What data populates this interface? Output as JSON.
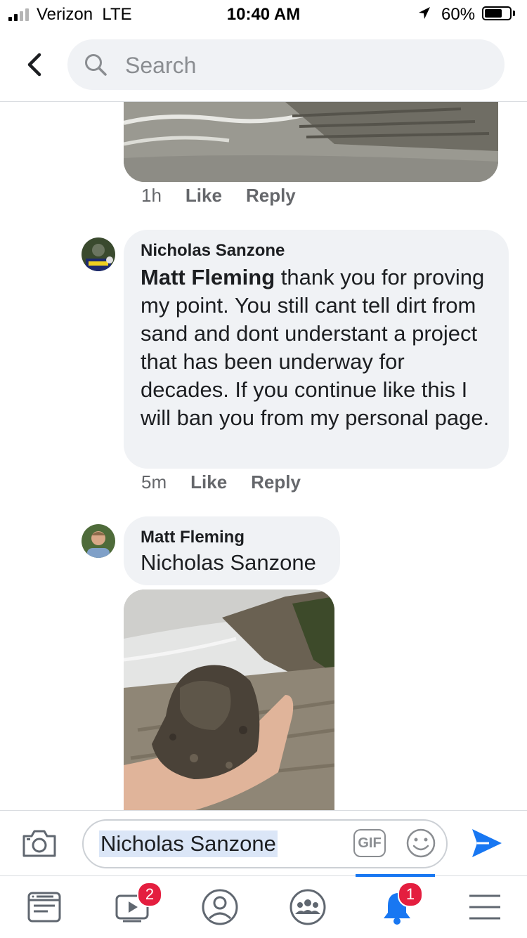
{
  "status_bar": {
    "carrier": "Verizon",
    "network": "LTE",
    "time": "10:40 AM",
    "battery": "60%",
    "battery_level": 0.6,
    "signal_bars": 2
  },
  "header": {
    "search_placeholder": "Search"
  },
  "thread": {
    "first_comment": {
      "time": "1h",
      "like_label": "Like",
      "reply_label": "Reply"
    },
    "comment_nicholas": {
      "author": "Nicholas Sanzone",
      "mention": "Matt Fleming",
      "text": " thank you for proving my point. You still cant tell dirt from sand and dont understant a project that has been underway for decades. If you continue like this I will ban you from my personal page.",
      "time": "5m",
      "like_label": "Like",
      "reply_label": "Reply"
    },
    "comment_matt": {
      "author": "Matt Fleming",
      "text": "Nicholas Sanzone"
    }
  },
  "composer": {
    "typed_text": "Nicholas Sanzone",
    "gif_label": "GIF"
  },
  "tabbar": {
    "active": "notifications",
    "watch_badge": "2",
    "notifications_badge": "1"
  },
  "colors": {
    "accent": "#1877f2",
    "badge": "#e41e3f",
    "bubble": "#f0f2f5",
    "meta_text": "#65676b"
  }
}
